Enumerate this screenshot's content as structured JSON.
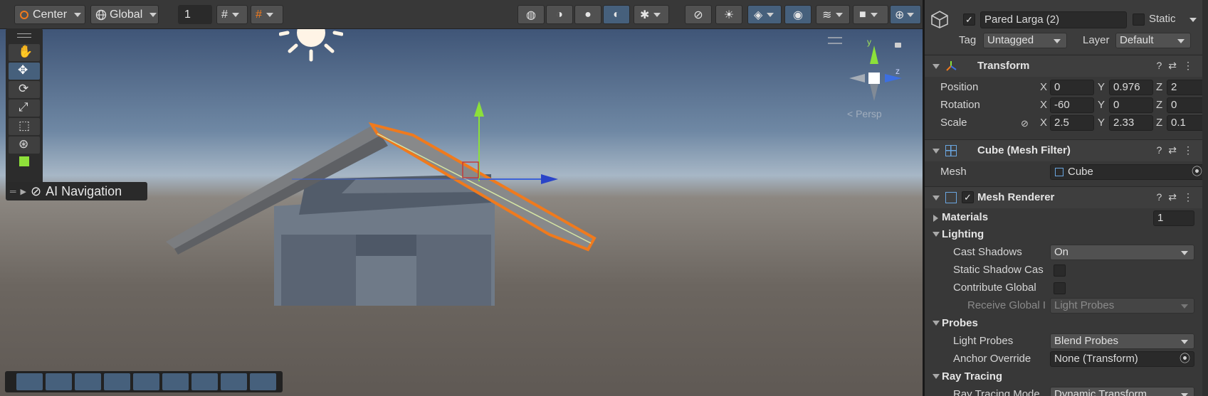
{
  "scene_toolbar": {
    "pivot_label": "Center",
    "space_label": "Global",
    "grid_value": "1"
  },
  "overlay": {
    "ai_navigation_label": "AI Navigation",
    "gizmo_y": "y",
    "gizmo_z": "z",
    "projection_label": "Persp"
  },
  "inspector": {
    "object_name": "Pared Larga (2)",
    "active_checked": true,
    "static_label": "Static",
    "tag_label": "Tag",
    "tag_value": "Untagged",
    "layer_label": "Layer",
    "layer_value": "Default",
    "transform": {
      "title": "Transform",
      "position_label": "Position",
      "rotation_label": "Rotation",
      "scale_label": "Scale",
      "position": {
        "x": "0",
        "y": "0.976",
        "z": "2"
      },
      "rotation": {
        "x": "-60",
        "y": "0",
        "z": "0"
      },
      "scale": {
        "x": "2.5",
        "y": "2.33",
        "z": "0.1"
      },
      "axis_x": "X",
      "axis_y": "Y",
      "axis_z": "Z"
    },
    "mesh_filter": {
      "title": "Cube (Mesh Filter)",
      "mesh_label": "Mesh",
      "mesh_value": "Cube"
    },
    "mesh_renderer": {
      "title": "Mesh Renderer",
      "materials_label": "Materials",
      "materials_count": "1",
      "lighting_label": "Lighting",
      "cast_shadows_label": "Cast Shadows",
      "cast_shadows_value": "On",
      "static_shadow_label": "Static Shadow Cas",
      "contribute_global_label": "Contribute Global",
      "receive_global_label": "Receive Global I",
      "receive_global_value": "Light Probes",
      "probes_label": "Probes",
      "light_probes_label": "Light Probes",
      "light_probes_value": "Blend Probes",
      "anchor_override_label": "Anchor Override",
      "anchor_override_value": "None (Transform)",
      "ray_tracing_label": "Ray Tracing",
      "ray_tracing_mode_label": "Ray Tracing Mode",
      "ray_tracing_mode_value": "Dynamic Transform"
    }
  },
  "colors": {
    "selection_outline": "#f07a1d",
    "accent_blue": "#46607c",
    "panel_bg": "#383838"
  }
}
